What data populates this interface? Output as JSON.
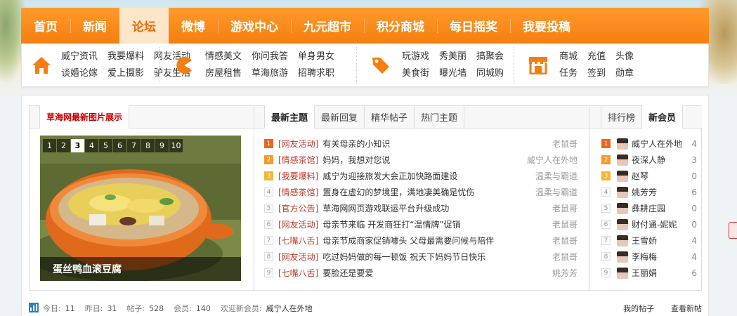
{
  "nav": {
    "items": [
      "首页",
      "新闻",
      "论坛",
      "微博",
      "游戏中心",
      "九元超市",
      "积分商城",
      "每日摇奖",
      "我要投稿"
    ],
    "active_index": 2
  },
  "subnav": {
    "groups": [
      {
        "icon": "home-icon",
        "links": [
          "威宁资讯",
          "谈婚论嫁",
          "我要爆料",
          "爱上摄影",
          "网友活动",
          "驴友生活"
        ]
      },
      {
        "icon": "pacman-icon",
        "links": [
          "情感美文",
          "房屋租售",
          "你问我答",
          "草海旅游",
          "单身男女",
          "招聘求职"
        ]
      },
      {
        "icon": "tag-icon",
        "links": [
          "玩游戏",
          "美食街",
          "秀美丽",
          "曝光墙",
          "搞聚会",
          "同城购"
        ]
      },
      {
        "icon": "shop-icon",
        "links": [
          "商城",
          "任务",
          "充值",
          "签到",
          "头像",
          "勋章"
        ]
      }
    ]
  },
  "pictures": {
    "tab_label": "草海网最新图片展示",
    "pager": [
      "1",
      "2",
      "3",
      "4",
      "5",
      "6",
      "7",
      "8",
      "9",
      "10"
    ],
    "active_page": "3",
    "caption": "蛋丝鸭血滚豆腐"
  },
  "topics": {
    "tabs": [
      "最新主题",
      "最新回复",
      "精华帖子",
      "热门主题"
    ],
    "active_tab": 0,
    "rows": [
      {
        "n": "1",
        "cat": "[网友活动]",
        "title": "有关母亲的小知识",
        "author": "老鼠哥"
      },
      {
        "n": "2",
        "cat": "[情感茶馆]",
        "title": "妈妈，我想对您说",
        "author": "威宁人在外地"
      },
      {
        "n": "3",
        "cat": "[我要爆料]",
        "title": "威宁为迎接旅发大会正加快路面建设",
        "author": "温柔与霸道"
      },
      {
        "n": "4",
        "cat": "[情感茶馆]",
        "title": "置身在虚幻的梦境里，满地凄美确是忧伤",
        "author": "温柔与霸道"
      },
      {
        "n": "5",
        "cat": "[官方公告]",
        "title": "草海网网页游戏联运平台升级成功",
        "author": "老鼠哥"
      },
      {
        "n": "6",
        "cat": "[网友活动]",
        "title": "母亲节来临  开发商狂打“温情牌”促销",
        "author": "老鼠哥"
      },
      {
        "n": "7",
        "cat": "[七嘴八舌]",
        "title": "母亲节成商家促销噱头  父母最需要问候与陪伴",
        "author": "老鼠哥"
      },
      {
        "n": "8",
        "cat": "[网友活动]",
        "title": "吃过妈妈做的每一顿饭  祝天下妈妈节日快乐",
        "author": "老鼠哥"
      },
      {
        "n": "9",
        "cat": "[七嘴八舌]",
        "title": "要脸还是要爱",
        "author": "姚芳芳"
      }
    ]
  },
  "members": {
    "tabs": [
      "排行榜",
      "新会员"
    ],
    "active_tab": 1,
    "rows": [
      {
        "n": "1",
        "name": "威宁人在外地",
        "count": "4"
      },
      {
        "n": "2",
        "name": "夜深人静",
        "count": "3"
      },
      {
        "n": "3",
        "name": "赵琴",
        "count": "0"
      },
      {
        "n": "4",
        "name": "姚芳芳",
        "count": "6"
      },
      {
        "n": "5",
        "name": "彝耕庄园",
        "count": "0"
      },
      {
        "n": "6",
        "name": "财付通-妮妮",
        "count": "0"
      },
      {
        "n": "7",
        "name": "王雪娇",
        "count": "4"
      },
      {
        "n": "8",
        "name": "李梅梅",
        "count": "4"
      },
      {
        "n": "9",
        "name": "王丽娟",
        "count": "6"
      }
    ]
  },
  "stats": {
    "today_label": "今日:",
    "today": "11",
    "yesterday_label": "昨日:",
    "yesterday": "31",
    "posts_label": "帖子:",
    "posts": "528",
    "members_label": "会员:",
    "members": "140",
    "welcome_label": "欢迎新会员:",
    "welcome_name": "威宁人在外地",
    "my_posts": "我的帖子",
    "view_new": "查看新帖"
  },
  "colors": {
    "brand_orange": "#f57e0e",
    "category_red": "#c0392b"
  }
}
